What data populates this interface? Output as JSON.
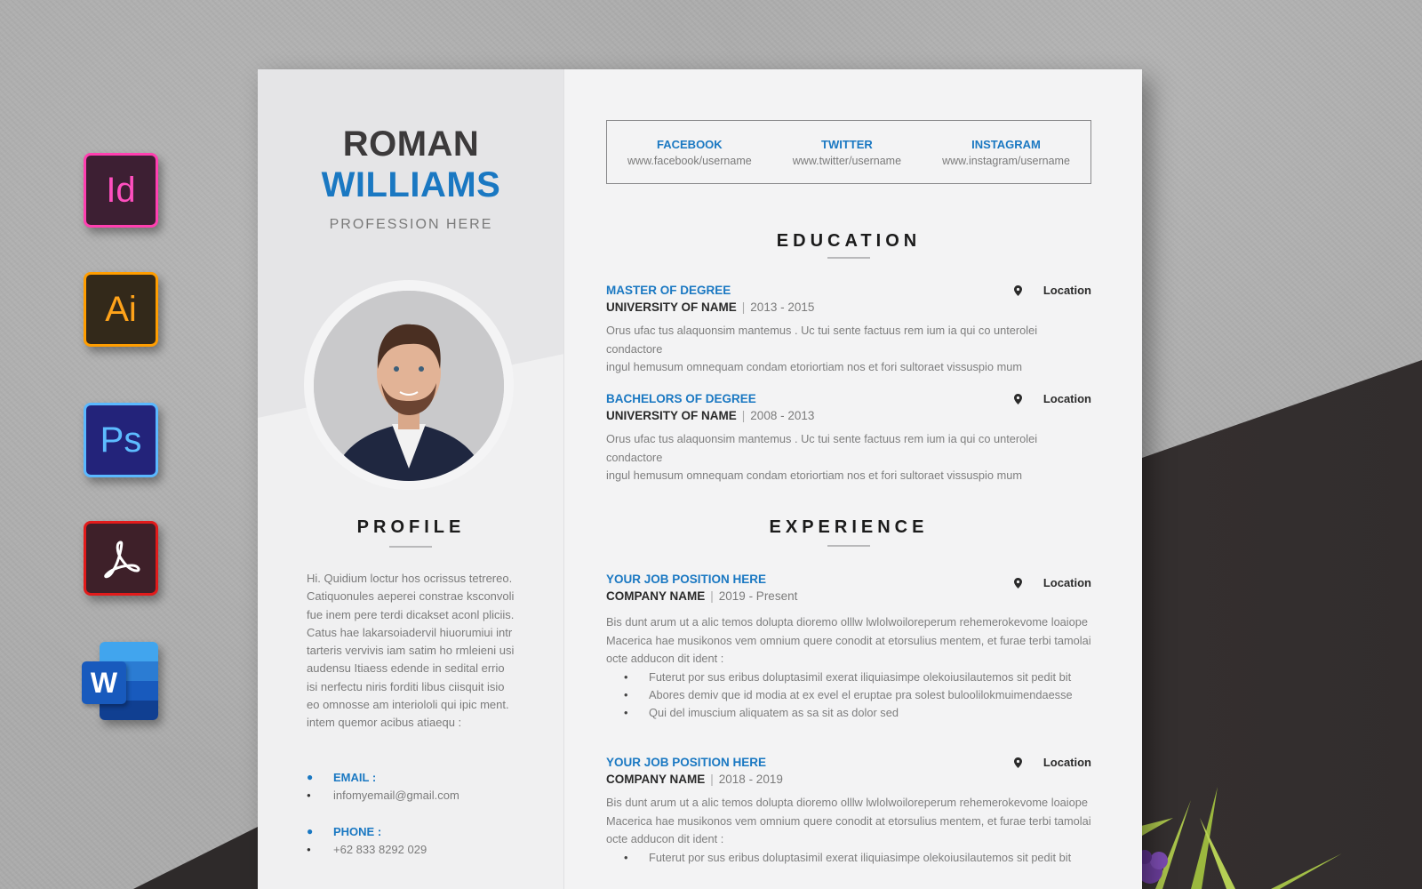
{
  "app_icons": [
    {
      "name": "indesign",
      "label": "Id",
      "colors": {
        "bg": "#3d1f33",
        "border": "#ff3fb0",
        "text": "#ff4fbf"
      }
    },
    {
      "name": "illustrator",
      "label": "Ai",
      "colors": {
        "bg": "#33291a",
        "border": "#ff9d00",
        "text": "#ffa31a"
      }
    },
    {
      "name": "photoshop",
      "label": "Ps",
      "colors": {
        "bg": "#23237a",
        "border": "#5ab8ff",
        "text": "#5dbcff"
      }
    },
    {
      "name": "acrobat",
      "label": "",
      "colors": {
        "bg": "#3e2029",
        "border": "#e21b1b"
      }
    },
    {
      "name": "word",
      "label": "W",
      "colors": {
        "bg": "#185abd"
      }
    }
  ],
  "resume": {
    "name_first": "ROMAN",
    "name_last": "WILLIAMS",
    "profession": "PROFESSION HERE",
    "accent_color": "#1a78c2",
    "social": [
      {
        "name": "FACEBOOK",
        "url": "www.facebook/username"
      },
      {
        "name": "TWITTER",
        "url": "www.twitter/username"
      },
      {
        "name": "INSTAGRAM",
        "url": "www.instagram/username"
      }
    ],
    "profile": {
      "title": "PROFILE",
      "lines": [
        "Hi. Quidium loctur hos ocrissus tetrereo.",
        "Catiquonules aeperei constrae ksconvoli",
        "fue inem pere terdi dicakset aconl pliciis.",
        "Catus hae lakarsoiadervil hiuorumiui intr",
        "tarteris vervivis iam satim ho rmleieni usi",
        "audensu Itiaess edende in sedital errio",
        "isi nerfectu niris forditi libus ciisquit isio",
        "eo omnosse am interiololi qui ipic ment.",
        "intem quemor acibus atiaequ :"
      ]
    },
    "contact": [
      {
        "label": "EMAIL :",
        "value": "infomyemail@gmail.com"
      },
      {
        "label": "PHONE :",
        "value": "+62 833 8292 029"
      }
    ],
    "education": {
      "title": "EDUCATION",
      "entries": [
        {
          "degree": "MASTER OF DEGREE",
          "school": "UNIVERSITY OF  NAME",
          "dates": "2013 - 2015",
          "location": "Location",
          "desc_lines": [
            "Orus ufac tus alaquonsim mantemus . Uc tui sente factuus rem ium ia qui co unterolei condactore",
            "ingul hemusum omnequam condam etoriortiam nos et fori sultoraet vissuspio mum"
          ]
        },
        {
          "degree": "BACHELORS OF DEGREE",
          "school": "UNIVERSITY OF  NAME",
          "dates": "2008 - 2013",
          "location": "Location",
          "desc_lines": [
            "Orus ufac tus alaquonsim mantemus . Uc tui sente factuus rem ium ia qui co unterolei condactore",
            "ingul hemusum omnequam condam etoriortiam nos et fori sultoraet vissuspio mum"
          ]
        }
      ]
    },
    "experience": {
      "title": "EXPERIENCE",
      "entries": [
        {
          "position": "YOUR JOB POSITION HERE",
          "company": "COMPANY  NAME",
          "dates": "2019 - Present",
          "location": "Location",
          "desc_lines": [
            "Bis dunt arum ut a alic temos dolupta dioremo olllw lwlolwoiloreperum rehemerokevome loaiope",
            "Macerica hae musikonos vem omnium quere conodit at etorsulius mentem, et furae terbi tamolai",
            "octe adducon dit ident :"
          ],
          "bullets": [
            "Futerut por sus eribus doluptasimil exerat iliquiasimpe olekoiusilautemos sit pedit bit",
            "Abores demiv que id modia at ex evel el eruptae pra solest buloolilokmuimendaesse",
            "Qui del imuscium aliquatem as sa sit as dolor sed"
          ]
        },
        {
          "position": "YOUR JOB POSITION HERE",
          "company": "COMPANY  NAME",
          "dates": "2018 - 2019",
          "location": "Location",
          "desc_lines": [
            "Bis dunt arum ut a alic temos dolupta dioremo olllw lwlolwoiloreperum rehemerokevome loaiope",
            "Macerica hae musikonos vem omnium quere conodit at etorsulius mentem, et furae terbi tamolai",
            "octe adducon dit ident :"
          ],
          "bullets": [
            "Futerut por sus eribus doluptasimil exerat iliquiasimpe olekoiusilautemos sit pedit bit"
          ]
        }
      ]
    }
  }
}
